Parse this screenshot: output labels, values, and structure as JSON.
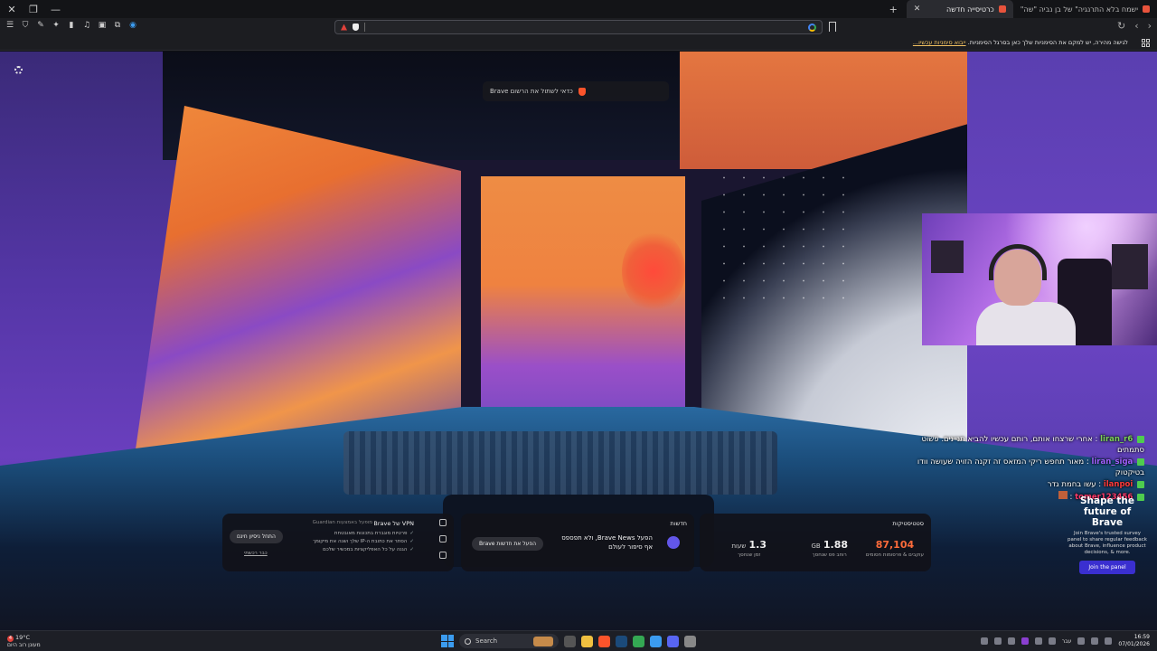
{
  "window": {
    "tabs": [
      {
        "label": "ישמח בלא התרנגיה\" של בן נביה \"שה\"",
        "active": false
      },
      {
        "label": "כרטיסייה חדשה",
        "active": true
      }
    ],
    "new_tab": "+"
  },
  "toolbar": {
    "url_value": "",
    "url_placeholder": ""
  },
  "infobar": {
    "text": "לגישה מהירה, יש למקם את הסימניות שלך כאן בסרגל הסימניות.",
    "link": "ייבוא סימניות עכשיו..."
  },
  "newtab": {
    "notice": "כדאי לשתול את הרשום Brave",
    "vpn": {
      "title": "VPN של Brave",
      "subtitle": "מופעל באמצעות Guardian",
      "features": [
        "פרטיות מוגברת בתכונות מאובטחת",
        "הסתר את כתובת ה-IP שלך ושנה את מיקומך",
        "הגנה על כל האפליקציות במכשיר שלכם"
      ],
      "button": "התחל ניסיון חינם",
      "link": "כבר רכשתי"
    },
    "news": {
      "title": "חדשות",
      "headline": "הפעל Brave News, ולא תפספס אף סיפור לעולם",
      "button": "הפעל את חדשות Brave"
    },
    "stats": {
      "title": "סטטיסטיקות",
      "items": [
        {
          "value": "87,104",
          "label": "עוקבים & פרסומות חסומים",
          "accent": true
        },
        {
          "value": "1.88",
          "unit": "GB",
          "label": "רוחב פס שנחסך",
          "accent": false
        },
        {
          "value": "1.3",
          "unit": "שעות",
          "label": "זמן שנחסך",
          "accent": false
        }
      ]
    },
    "promo": {
      "title": "Shape the future of Brave",
      "body": "Join Brave's trusted survey panel to share regular feedback about Brave, influence product decisions, & more.",
      "button": "Join the panel"
    }
  },
  "chat": [
    {
      "user": "liran_r6",
      "text": "אחרי שרצחו אותם, רותם עכשיו להביא תניינים. פשוט סתמתים"
    },
    {
      "user": "liran_siga",
      "text": "מאור תחפש ריקי המזאס זה זקנה הזויה שעושה וודו בטיקטוק"
    },
    {
      "user": "ilanpoi",
      "text": "עשו בחמת גדר"
    },
    {
      "user": "tomer123456",
      "text": ""
    }
  ],
  "taskbar": {
    "weather_temp": "19°C",
    "weather_desc": "מעונן רוב היום",
    "alert_count": "4",
    "search_label": "Search",
    "language": "עבר",
    "time": "16:59",
    "date": "07/01/2026"
  },
  "colors": {
    "accent_orange": "#ff6b3a",
    "brave_red": "#fb542b",
    "promo_button": "#3a2fd0"
  }
}
